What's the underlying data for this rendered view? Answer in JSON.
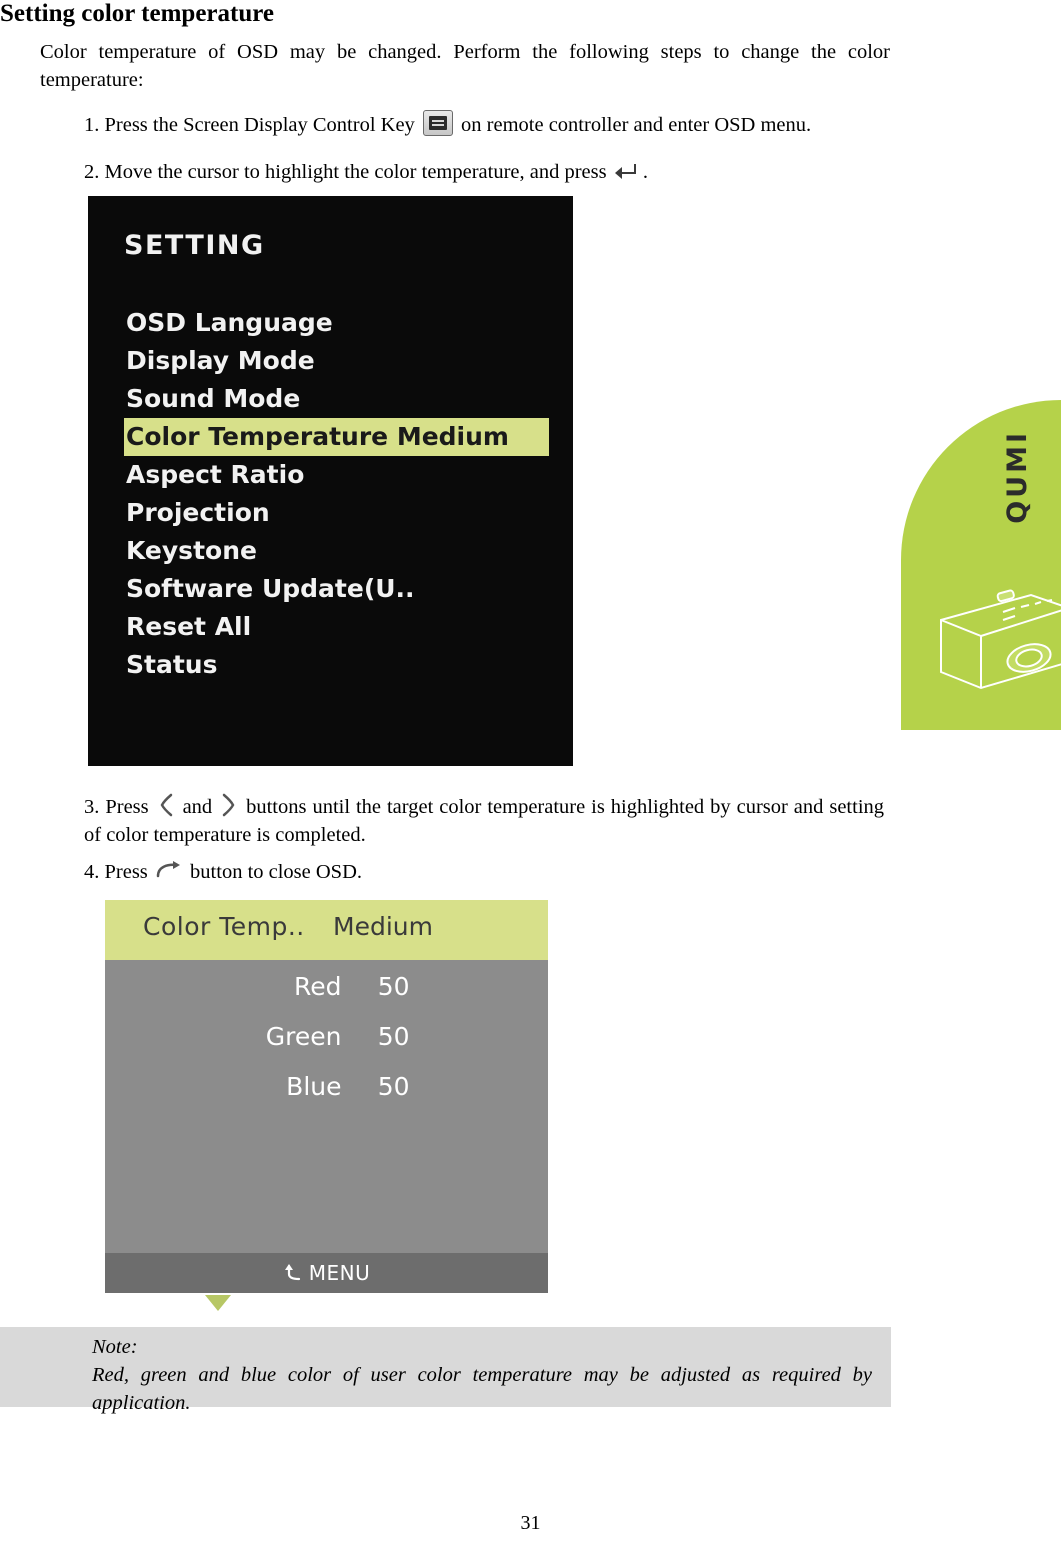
{
  "heading": "Setting color temperature",
  "intro": "Color temperature of OSD may be changed. Perform the following steps to change the color temperature:",
  "steps": {
    "step1_a": "1. Press the Screen Display Control Key",
    "step1_b": "on remote controller and enter OSD menu.",
    "step2_a": "2. Move the cursor to highlight the color temperature, and press",
    "step2_b": ".",
    "step3_a": "3. Press",
    "step3_b": "and",
    "step3_c": "buttons until the target color temperature is highlighted by cursor and setting of color temperature is completed.",
    "step4_a": "4. Press",
    "step4_b": "button to close OSD."
  },
  "icons": {
    "osd_key": "osd-menu-key-icon",
    "enter_key": "enter-arrow-icon",
    "left_key": "left-chevron-icon",
    "right_key": "right-chevron-icon",
    "back_key": "back-arrow-icon"
  },
  "osd_setting": {
    "title": "SETTING",
    "items": [
      {
        "label": "OSD Language",
        "value": "",
        "selected": false
      },
      {
        "label": "Display Mode",
        "value": "",
        "selected": false
      },
      {
        "label": "Sound Mode",
        "value": "",
        "selected": false
      },
      {
        "label": "Color Temperature Medium",
        "value": "Medium",
        "selected": true
      },
      {
        "label": "Aspect Ratio",
        "value": "",
        "selected": false
      },
      {
        "label": "Projection",
        "value": "",
        "selected": false
      },
      {
        "label": "Keystone",
        "value": "",
        "selected": false
      },
      {
        "label": "Software Update(U..",
        "value": "",
        "selected": false
      },
      {
        "label": "Reset All",
        "value": "",
        "selected": false
      },
      {
        "label": "Status",
        "value": "",
        "selected": false
      }
    ],
    "highlight_color": "#d7e08a",
    "background_color": "#0a0a0a"
  },
  "osd_color_temp": {
    "header_label": "Color Temp..",
    "header_value": "Medium",
    "rows": [
      {
        "label": "Red",
        "value": "50"
      },
      {
        "label": "Green",
        "value": "50"
      },
      {
        "label": "Blue",
        "value": "50"
      }
    ],
    "footer_label": "MENU",
    "header_color": "#d7e08a",
    "body_color": "#8c8c8c",
    "footer_color": "#6d6d6d"
  },
  "note": {
    "title": "Note:",
    "body": "Red, green and blue color of user color temperature may be adjusted as required by application.",
    "background_color": "#d9d9d9"
  },
  "sidetab": {
    "brand": "QUMI",
    "color": "#b5d24a"
  },
  "page_number": "31"
}
